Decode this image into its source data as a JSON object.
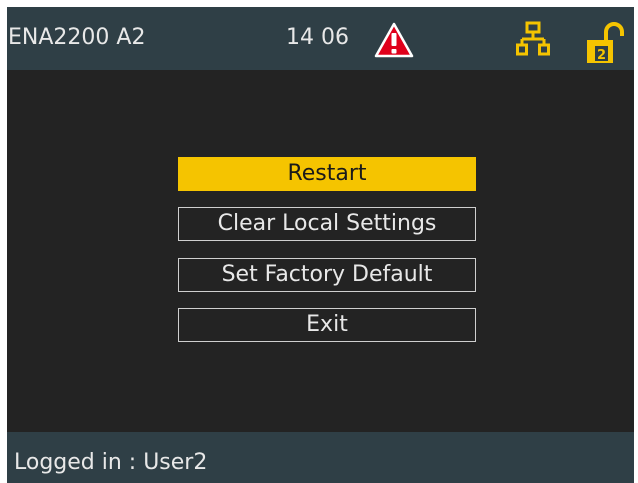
{
  "header": {
    "device_name": "ENA2200 A2",
    "time": "14 06",
    "icons": {
      "warning": "warning-triangle-icon",
      "network": "network-icon",
      "lock": "unlocked-padlock-icon",
      "lock_level": "2"
    }
  },
  "menu": {
    "items": [
      {
        "label": "Restart",
        "selected": true
      },
      {
        "label": "Clear Local Settings",
        "selected": false
      },
      {
        "label": "Set Factory Default",
        "selected": false
      },
      {
        "label": "Exit",
        "selected": false
      }
    ]
  },
  "footer": {
    "status": "Logged in : User2"
  },
  "colors": {
    "bar_background": "#2f3f46",
    "screen_background": "#232323",
    "accent": "#f5c400",
    "warning": "#e0001b",
    "text": "#e8e8e8"
  }
}
